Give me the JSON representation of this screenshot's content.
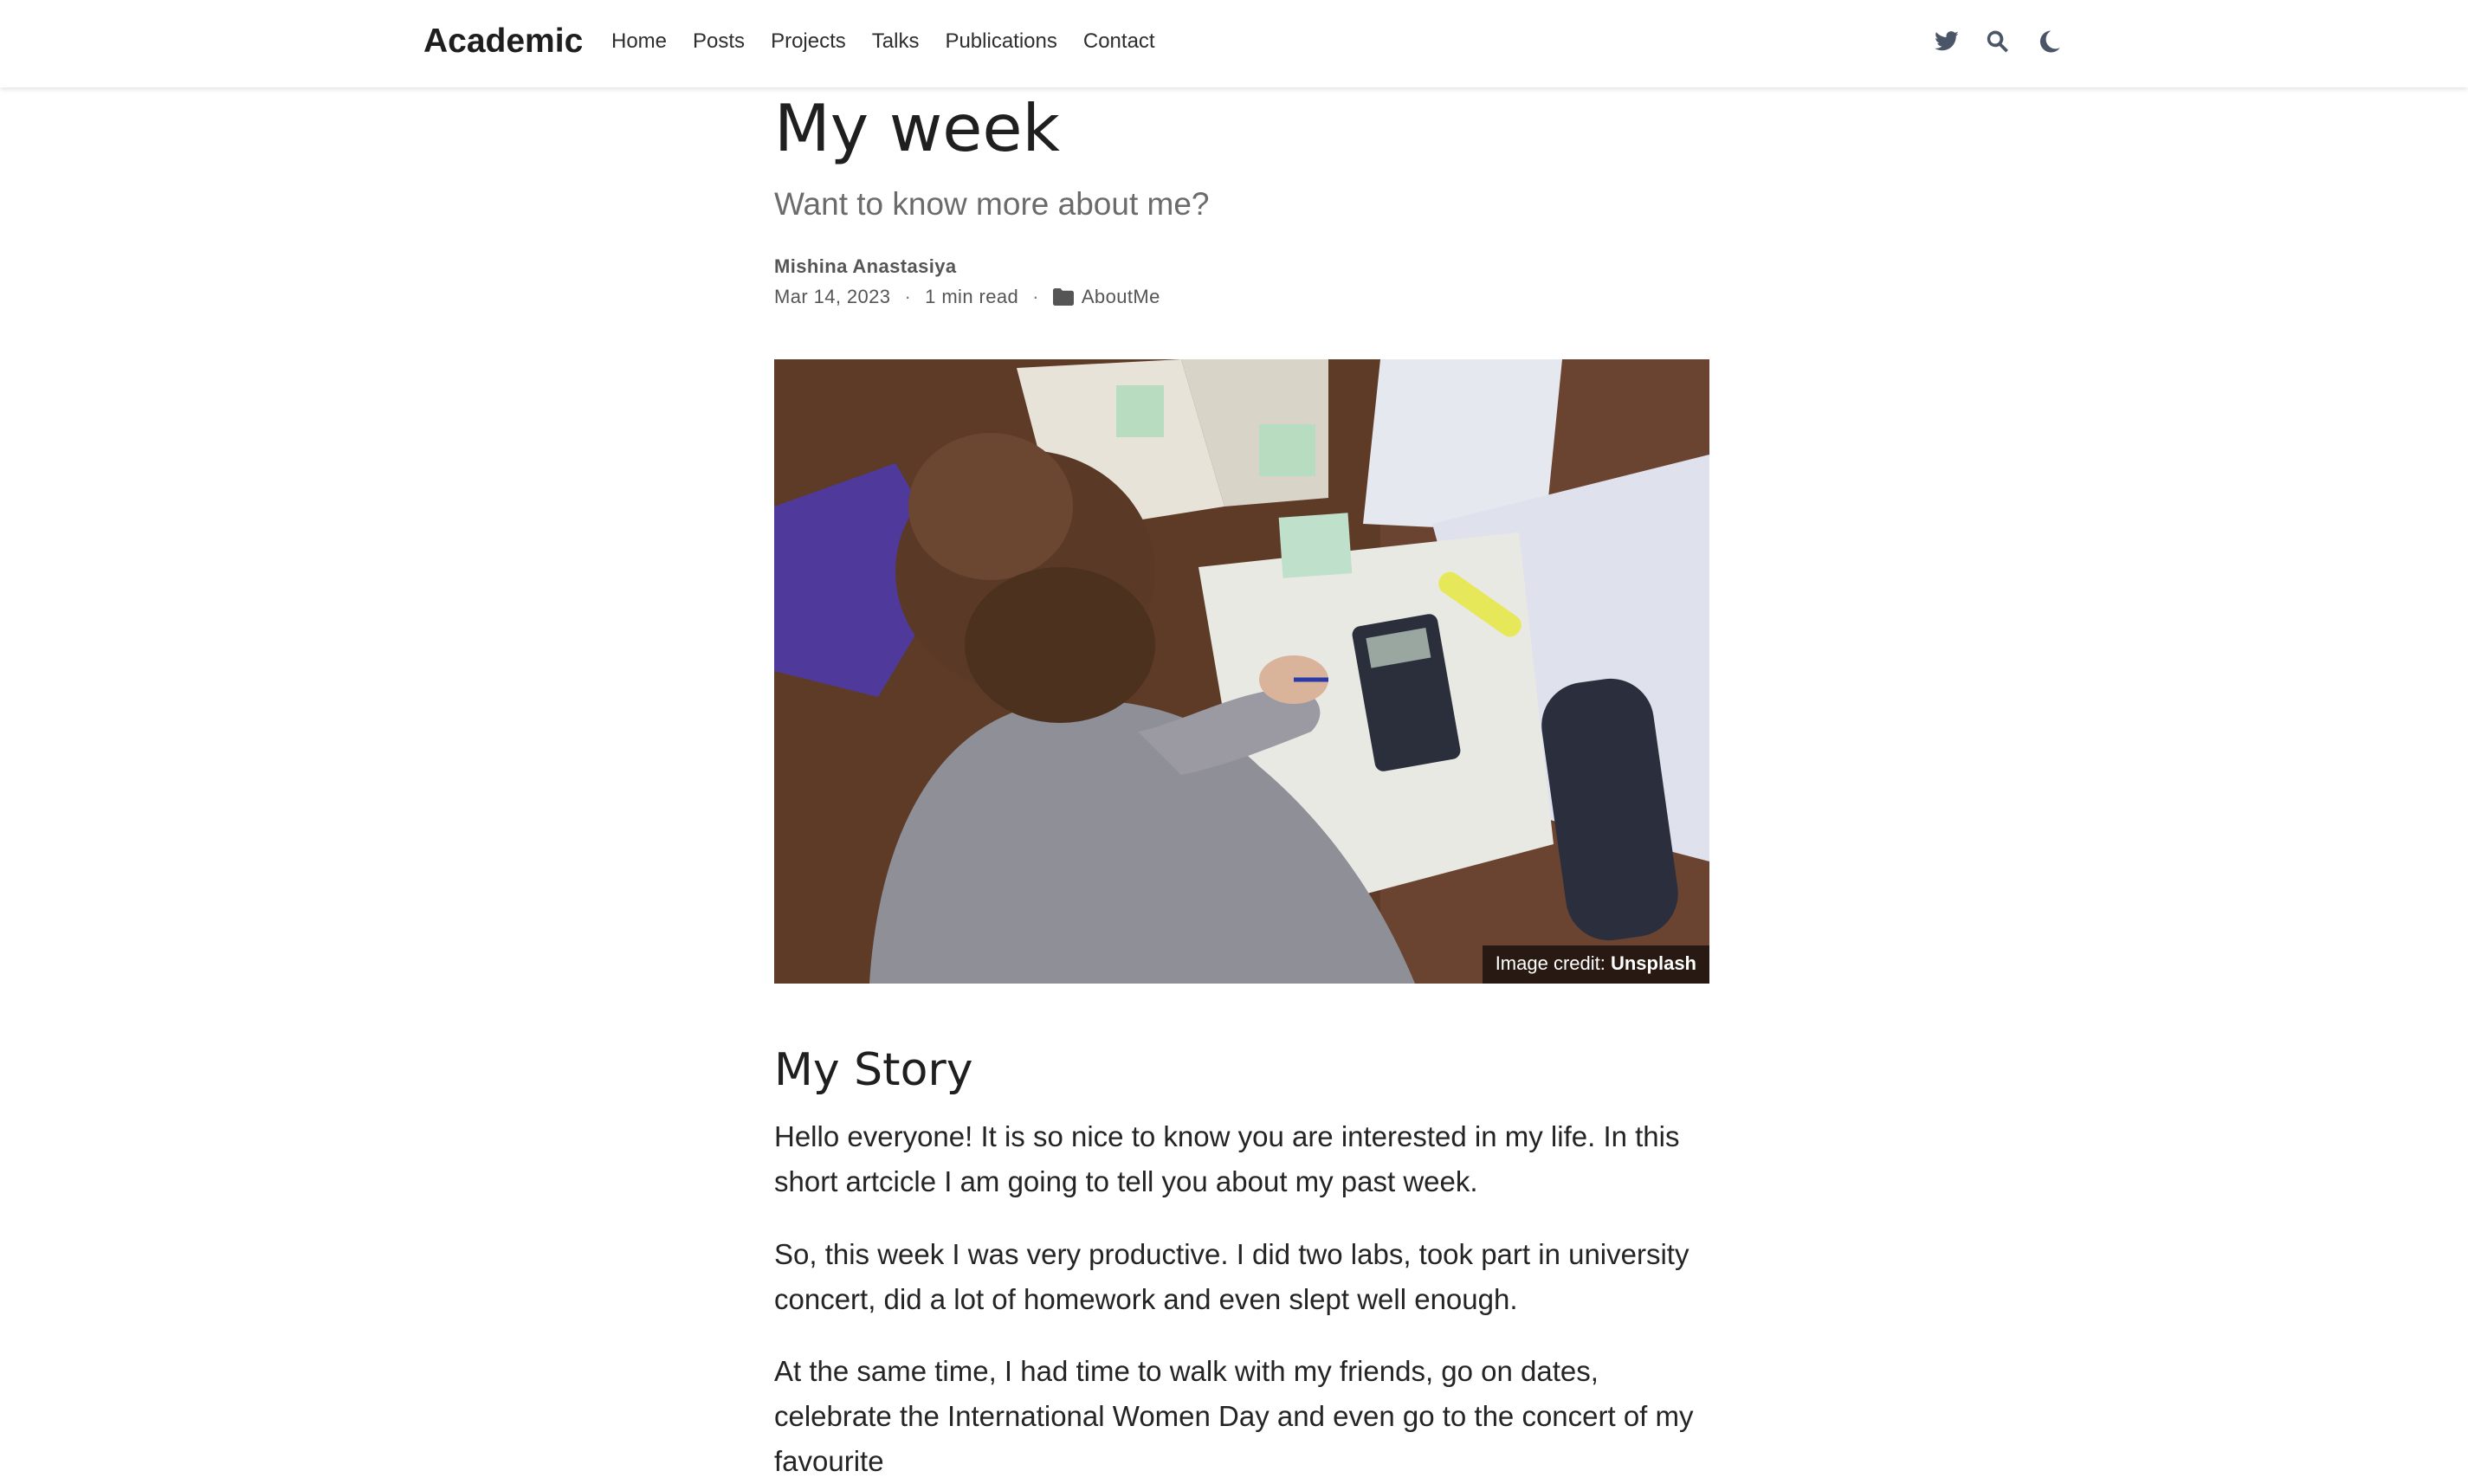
{
  "navbar": {
    "brand": "Academic",
    "links": [
      "Home",
      "Posts",
      "Projects",
      "Talks",
      "Publications",
      "Contact"
    ],
    "icons": [
      "twitter-icon",
      "search-icon",
      "moon-icon"
    ]
  },
  "article": {
    "title": "My week",
    "subtitle": "Want to know more about me?",
    "author": "Mishina Anastasiya",
    "date": "Mar 14, 2023",
    "separator": "·",
    "read_time": "1 min read",
    "category": "AboutMe",
    "image_credit_prefix": "Image credit: ",
    "image_credit_source": "Unsplash",
    "section_title": "My Story",
    "paragraphs": [
      "Hello everyone! It is so nice to know you are interested in my life. In this short artcicle I am going to tell you about my past week.",
      "So, this week I was very productive. I did two labs, took part in university concert, did a lot of homework and even slept well enough.",
      "At the same time, I had time to walk with my friends, go on dates, celebrate the International Women Day and even go to the concert of my favourite"
    ]
  }
}
